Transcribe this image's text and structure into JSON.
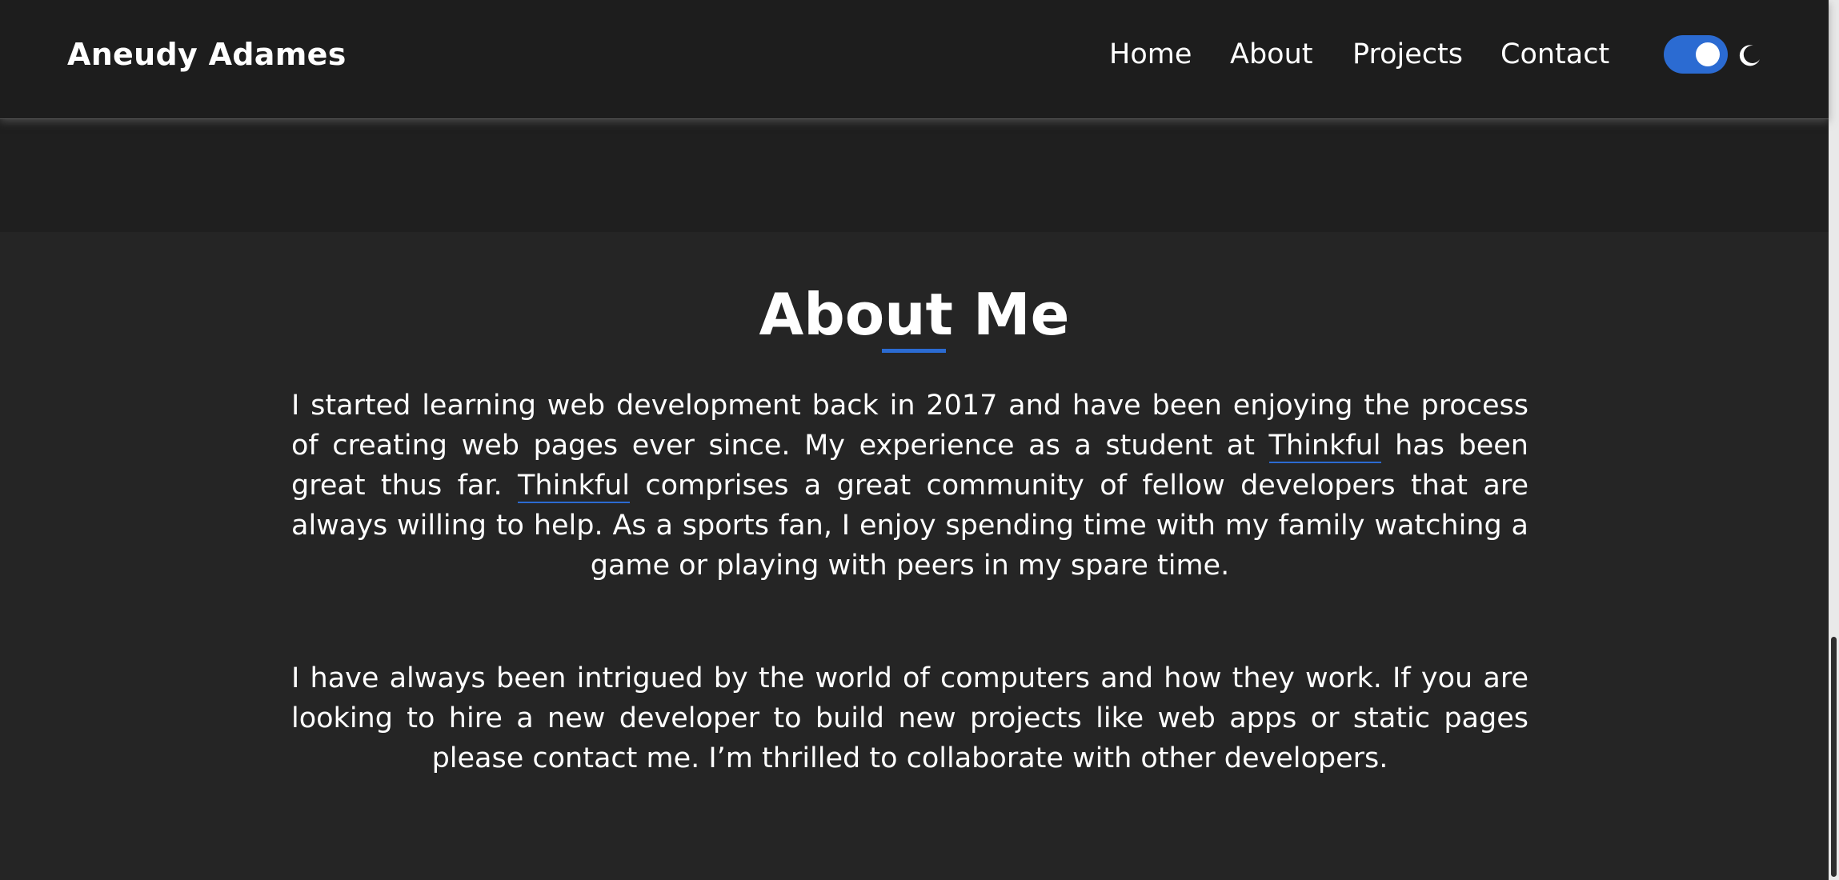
{
  "header": {
    "brand": "Aneudy Adames",
    "nav": {
      "home": "Home",
      "about": "About",
      "projects": "Projects",
      "contact": "Contact"
    },
    "theme_toggle": {
      "state": "on",
      "icon": "moon-icon",
      "accent_color": "#2b6bd2"
    }
  },
  "about": {
    "title": "About Me",
    "paragraph_1": {
      "before_link_1": "I started learning web development back in 2017 and have been enjoying the process of creating web pages ever since. My experience as a student at ",
      "link_1": "Thinkful",
      "between_links": " has been great thus far. ",
      "link_2": "Thinkful",
      "after_link_2": " comprises a great community of fellow developers that are always willing to help. As a sports fan, I enjoy spending time with my family watching a game or playing with peers in my spare time."
    },
    "paragraph_2": "I have always been intrigued by the world of computers and how they work. If you are looking to hire a new developer to build new projects like web apps or static pages please contact me. I’m thrilled to collaborate with other developers."
  },
  "colors": {
    "background": "#252525",
    "header_background": "#1d1d1d",
    "accent": "#2b6bd2",
    "text": "#ffffff"
  }
}
